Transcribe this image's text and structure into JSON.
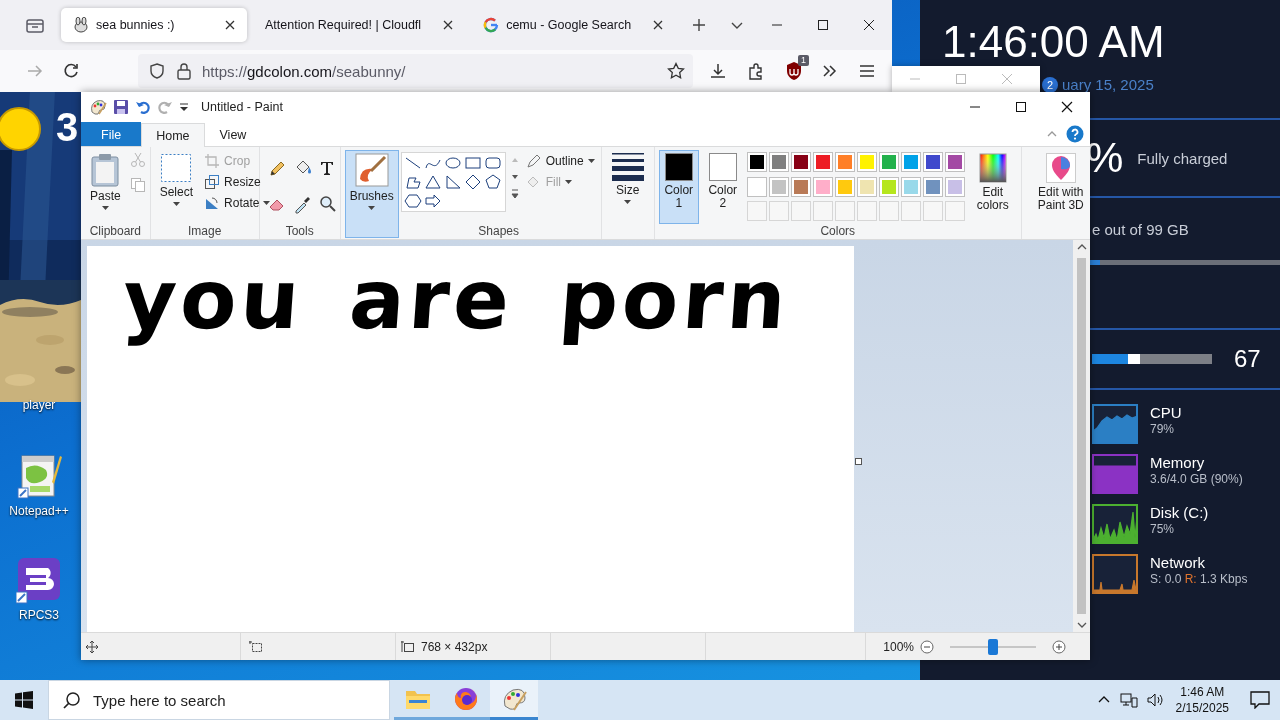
{
  "browser": {
    "tabs": [
      {
        "title": "sea bunnies :)",
        "kind": "bunny",
        "selected": true
      },
      {
        "title": "Attention Required! | Cloudfl",
        "kind": "none",
        "selected": false
      },
      {
        "title": "cemu - Google Search",
        "kind": "google",
        "selected": false
      }
    ],
    "url": {
      "scheme": "https://",
      "host": "gdcolon.com",
      "path": "/seabunny/"
    },
    "blocker_badge": "1"
  },
  "widgets": {
    "clock": {
      "time": "1:46:00 AM",
      "date": "uary 15, 2025",
      "badge": "2"
    },
    "battery": {
      "percent": "%",
      "status": "Fully charged"
    },
    "storage": {
      "text": "e out of 99 GB",
      "level": 0.05
    },
    "volume": {
      "level": 0.3,
      "reading": "67"
    },
    "performance": [
      {
        "name": "CPU",
        "color": "#2b7fc4",
        "value_parts": [
          {
            "text": "79%"
          }
        ]
      },
      {
        "name": "Memory",
        "color": "#8b32c4",
        "value_parts": [
          {
            "text": "3.6/4.0 GB (90%)"
          }
        ]
      },
      {
        "name": "Disk (C:)",
        "color": "#4cb030",
        "value_parts": [
          {
            "text": "75%"
          }
        ]
      },
      {
        "name": "Network",
        "color": "#c8782c",
        "value_parts": [
          {
            "text": "S: 0.0"
          },
          {
            "text": "R:",
            "color": "#e0742e"
          },
          {
            "text": "1.3 Kbps"
          }
        ]
      }
    ]
  },
  "desktop": {
    "picture": {
      "kind": "picture",
      "weather_reading": "3"
    },
    "icons": [
      {
        "label": "player",
        "kind": "hidden"
      },
      {
        "label": "Notepad++",
        "kind": "notepad"
      },
      {
        "label": "RPCS3",
        "kind": "rpcs3"
      }
    ]
  },
  "paint": {
    "title": "Untitled - Paint",
    "ribbon_tabs": [
      {
        "label": "File",
        "kind": "file",
        "selected": false
      },
      {
        "label": "Home",
        "kind": "tab",
        "selected": true
      },
      {
        "label": "View",
        "kind": "tab",
        "selected": false
      }
    ],
    "clipboard": {
      "label": "Clipboard",
      "paste": "Paste",
      "cut": {
        "disabled": true
      },
      "copy": {
        "disabled": true
      }
    },
    "image": {
      "label": "Image",
      "select": "Select",
      "commands": [
        {
          "label": "Crop",
          "kind": "crop",
          "disabled": true,
          "dropdown": false
        },
        {
          "label": "Resize",
          "kind": "resize",
          "disabled": false,
          "dropdown": false
        },
        {
          "label": "Rotate",
          "kind": "rotate",
          "disabled": false,
          "dropdown": true
        }
      ]
    },
    "tools": {
      "label": "Tools"
    },
    "brushes": {
      "label": "Brushes",
      "selected": true
    },
    "shapes": {
      "label": "Shapes",
      "options": [
        {
          "label": "Outline",
          "disabled": false
        },
        {
          "label": "Fill",
          "disabled": true
        }
      ]
    },
    "size": {
      "label": "Size"
    },
    "colors": {
      "label": "Colors",
      "slots": [
        {
          "label": "Color 1",
          "color": "#000000",
          "selected": true
        },
        {
          "label": "Color 2",
          "color": "#ffffff",
          "selected": false
        }
      ],
      "palette": [
        {
          "color": "#000000"
        },
        {
          "color": "#7f7f7f"
        },
        {
          "color": "#880015"
        },
        {
          "color": "#ed1c24"
        },
        {
          "color": "#ff7f27"
        },
        {
          "color": "#fff200"
        },
        {
          "color": "#22b14c"
        },
        {
          "color": "#00a2e8"
        },
        {
          "color": "#3f48cc"
        },
        {
          "color": "#a349a4"
        },
        {
          "color": "#ffffff"
        },
        {
          "color": "#c3c3c3"
        },
        {
          "color": "#b97a57"
        },
        {
          "color": "#ffaec9"
        },
        {
          "color": "#ffc90e"
        },
        {
          "color": "#efe4b0"
        },
        {
          "color": "#b5e61d"
        },
        {
          "color": "#99d9ea"
        },
        {
          "color": "#7092be"
        },
        {
          "color": "#c8bfe7"
        }
      ],
      "edit_colors": "Edit colors"
    },
    "paint3d": "Edit with Paint 3D",
    "canvas": {
      "drawing_text": "you are porn"
    },
    "status": {
      "dimensions": "768 × 432px",
      "zoom": "100%",
      "zoom_slider": {
        "level": 0.5
      }
    }
  },
  "taskbar": {
    "search_placeholder": "Type here to search",
    "apps": [
      {
        "kind": "explorer",
        "active": false
      },
      {
        "kind": "firefox",
        "active": false
      },
      {
        "kind": "paint",
        "active": true
      }
    ],
    "time": "1:46 AM",
    "date": "2/15/2025"
  }
}
